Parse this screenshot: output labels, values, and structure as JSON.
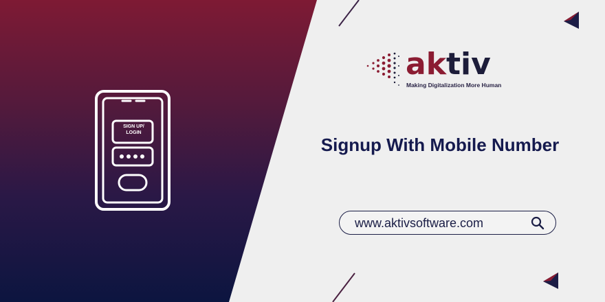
{
  "brand": {
    "name_part1": "ak",
    "name_part2": "tiv",
    "tagline": "Making Digitalization More Human"
  },
  "hero": {
    "phone_label_line1": "SIGN UP/",
    "phone_label_line2": "LOGIN",
    "headline": "Signup With Mobile Number"
  },
  "url_bar": {
    "value": "www.aktivsoftware.com",
    "icon": "search-icon"
  },
  "colors": {
    "brand_red": "#8b1c32",
    "brand_navy": "#151a4e",
    "gradient_top": "#7e1a34",
    "gradient_bottom": "#0c1540",
    "background": "#efefef"
  }
}
